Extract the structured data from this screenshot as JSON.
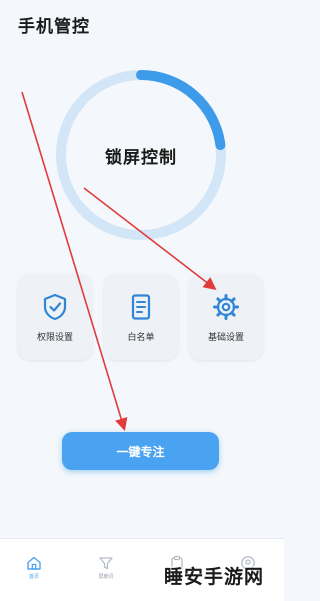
{
  "app": {
    "title": "手机管控"
  },
  "ring": {
    "label": "锁屏控制",
    "progress": 0.23,
    "accent": "#3d9be9",
    "track": "#d3e6f8"
  },
  "cards": [
    {
      "label": "权限设置",
      "icon": "shield-check-icon"
    },
    {
      "label": "白名单",
      "icon": "document-list-icon"
    },
    {
      "label": "基础设置",
      "icon": "gear-icon"
    }
  ],
  "focus_button": {
    "label": "一键专注",
    "color": "#4aa3f0"
  },
  "tabbar": {
    "items": [
      {
        "label": "首页",
        "icon": "home-icon",
        "active": true
      },
      {
        "label": "屏蔽词",
        "icon": "filter-icon",
        "active": false
      },
      {
        "label": "",
        "icon": "clipboard-icon",
        "active": false
      },
      {
        "label": "",
        "icon": "user-icon",
        "active": false
      }
    ]
  },
  "watermark": {
    "text": "睡安手游网"
  },
  "colors": {
    "annotation_arrow": "#e23b3b",
    "icon_blue": "#2f86d6"
  }
}
